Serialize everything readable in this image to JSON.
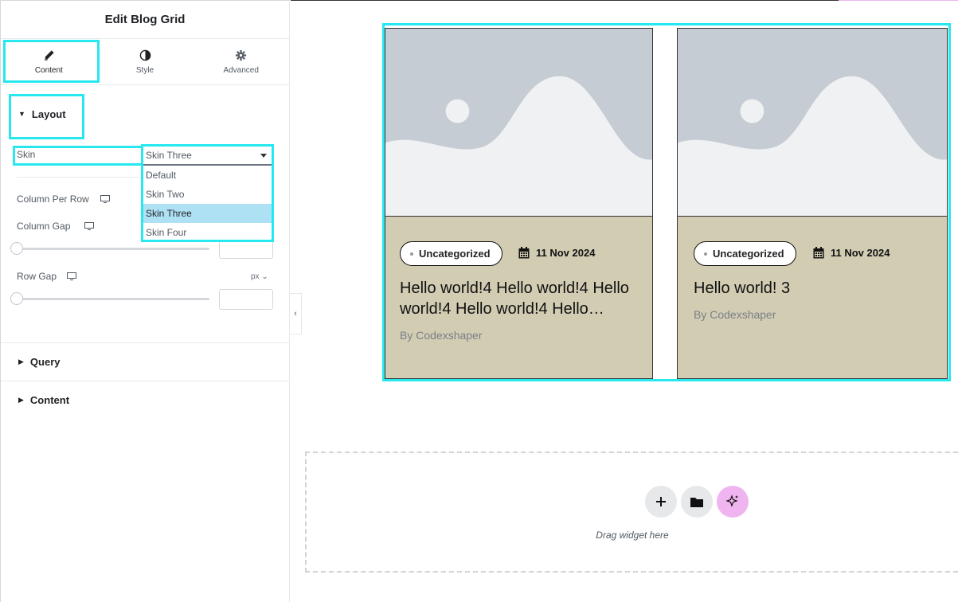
{
  "panel": {
    "title": "Edit Blog Grid",
    "tabs": [
      {
        "label": "Content",
        "icon": "pencil-icon",
        "active": true
      },
      {
        "label": "Style",
        "icon": "half-circle-icon",
        "active": false
      },
      {
        "label": "Advanced",
        "icon": "gear-icon",
        "active": false
      }
    ],
    "layout": {
      "title": "Layout",
      "skin_label": "Skin",
      "skin_value": "Skin Three",
      "skin_options": [
        "Default",
        "Skin Two",
        "Skin Three",
        "Skin Four"
      ],
      "column_per_row_label": "Column Per Row",
      "column_gap_label": "Column Gap",
      "row_gap_label": "Row Gap",
      "row_gap_unit": "px"
    },
    "query_title": "Query",
    "content_title": "Content"
  },
  "posts": [
    {
      "category": "Uncategorized",
      "date": "11 Nov 2024",
      "title": "Hello world!4 Hello world!4 Hello world!4 Hello world!4 Hello…",
      "author": "By Codexshaper"
    },
    {
      "category": "Uncategorized",
      "date": "11 Nov 2024",
      "title": "Hello world! 3",
      "author": "By Codexshaper"
    }
  ],
  "drop_zone": {
    "text": "Drag widget here"
  },
  "colors": {
    "highlight": "#26e8ee",
    "card_bg": "#d2ccb3",
    "placeholder_bg": "#c6ccd3",
    "ai_button": "#f0b5f0",
    "selected_option": "#aee1f4"
  }
}
